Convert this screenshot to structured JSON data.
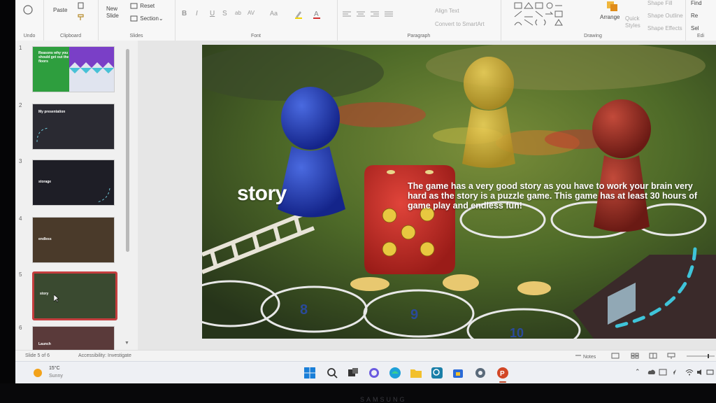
{
  "ribbon": {
    "undo_label": "Undo",
    "clipboard": {
      "paste_label": "Paste",
      "group_label": "Clipboard"
    },
    "slides": {
      "new_slide_label": "New\nSlide",
      "reset_label": "Reset",
      "section_label": "Section",
      "group_label": "Slides"
    },
    "font": {
      "group_label": "Font",
      "format_letters": [
        "B",
        "I",
        "U",
        "S",
        "ab",
        "AV",
        "Aa"
      ]
    },
    "paragraph": {
      "group_label": "Paragraph",
      "align_text_label": "Align Text",
      "smartart_label": "Convert to SmartArt"
    },
    "drawing": {
      "arrange_label": "Arrange",
      "quick_styles_label": "Quick\nStyles",
      "shape_fill_label": "Shape Fill",
      "shape_outline_label": "Shape Outline",
      "shape_effects_label": "Shape Effects",
      "group_label": "Drawing"
    },
    "editing": {
      "find_label": "Find",
      "replace_label": "Re",
      "select_label": "Sel",
      "group_label": "Edi"
    }
  },
  "thumbnails": [
    {
      "number": "1",
      "title": "Reasons why you should get out the floors",
      "colors": {
        "left": "#2e9e3e",
        "right": "#7a3fc7"
      }
    },
    {
      "number": "2",
      "title": "My presentation",
      "colors": {
        "bg": "#2a2a32"
      }
    },
    {
      "number": "3",
      "title": "storage",
      "colors": {
        "bg": "#1e1e26"
      }
    },
    {
      "number": "4",
      "title": "endless",
      "colors": {
        "bg": "#4a3a2a"
      }
    },
    {
      "number": "5",
      "title": "story",
      "colors": {
        "bg": "#3a4a30"
      },
      "selected": true
    },
    {
      "number": "6",
      "title": "Launch",
      "colors": {
        "bg": "#5a3a3a"
      }
    }
  ],
  "slide": {
    "title": "story",
    "body": "The game has a very good story as you have to work your brain very hard as the story is a puzzle game. This game has at least 30 hours of game play and endless fun!"
  },
  "statusbar": {
    "slide_counter": "Slide 5 of 6",
    "accessibility": "Accessibility: Investigate",
    "notes_label": "Notes"
  },
  "taskbar": {
    "weather_temp": "15°C",
    "weather_desc": "Sunny"
  },
  "monitor_brand": "SAMSUNG",
  "colors": {
    "accent": "#c43e3e",
    "cyan_arc": "#3fc4d9"
  }
}
